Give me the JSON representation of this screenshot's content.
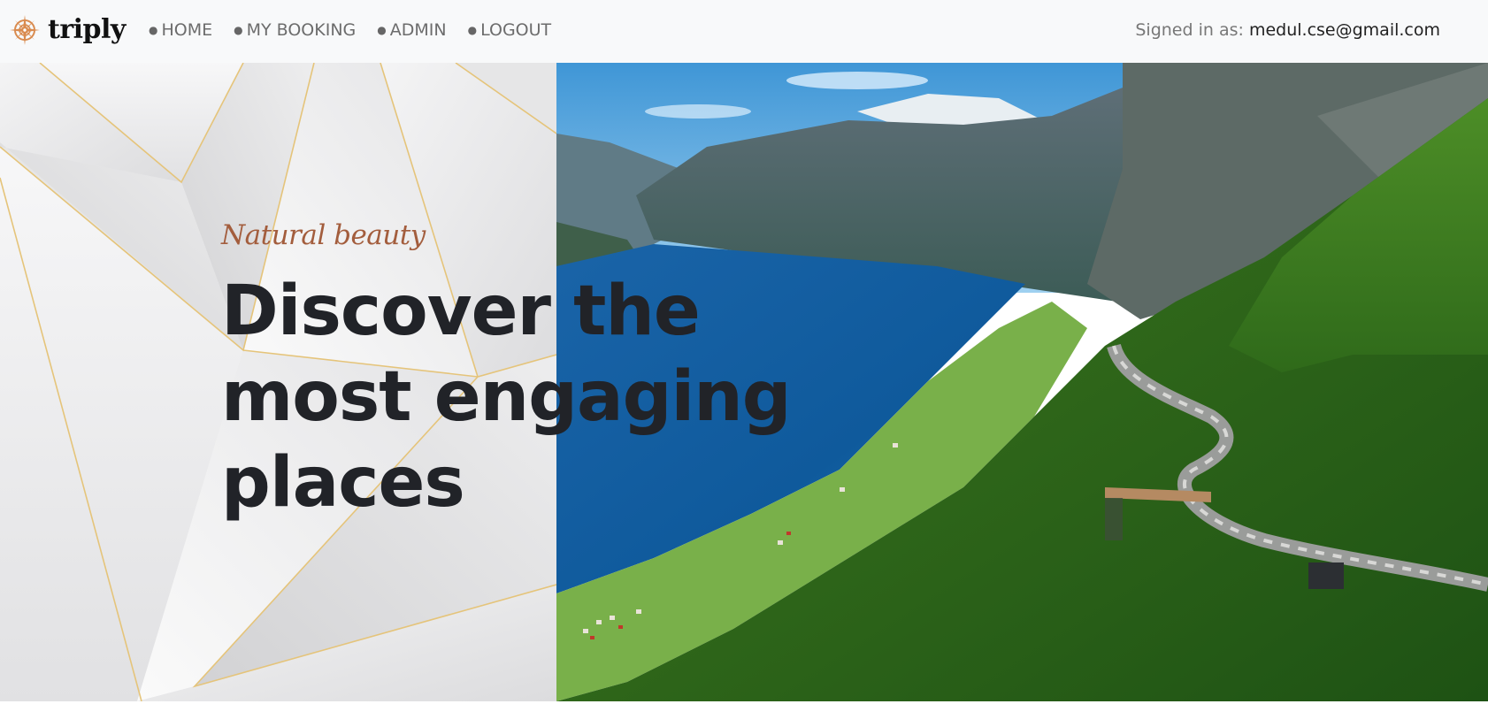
{
  "brand": {
    "name": "triply",
    "logo_icon": "compass-icon",
    "accent_color": "#d98b4f"
  },
  "nav": {
    "items": [
      {
        "label": "HOME"
      },
      {
        "label": "MY BOOKING"
      },
      {
        "label": "ADMIN"
      },
      {
        "label": "LOGOUT"
      }
    ],
    "bullet": "●"
  },
  "user": {
    "prefix": "Signed in as:",
    "email": "medul.cse@gmail.com"
  },
  "hero": {
    "tagline": "Natural beauty",
    "headline_lines": [
      "Discover the",
      "most engaging",
      "places"
    ],
    "tagline_color": "#a35d3d",
    "headline_color": "#212328"
  }
}
